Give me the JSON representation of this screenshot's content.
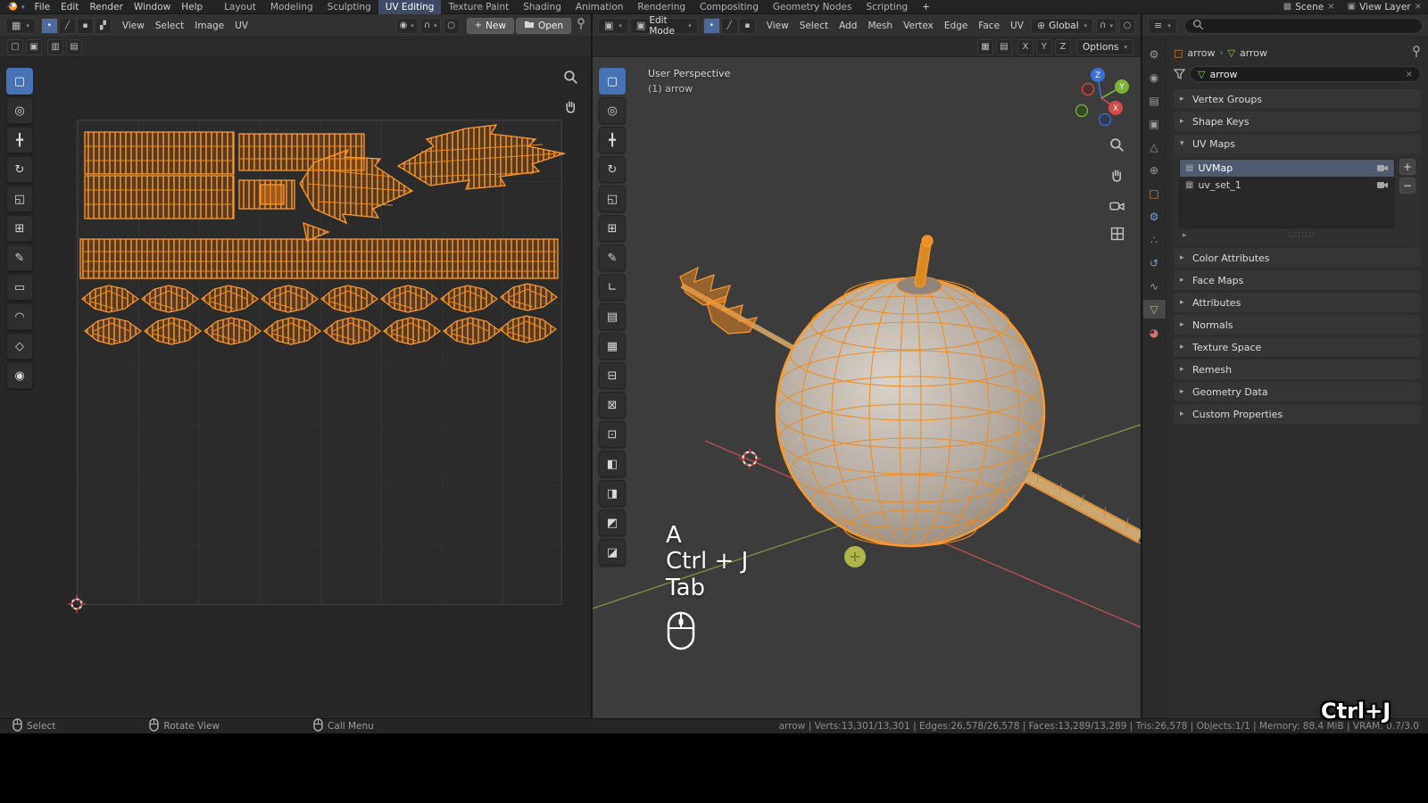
{
  "icons": {
    "dropdown_caret": "▾",
    "chevron_collapsed": "▸",
    "chevron_expanded": "▾",
    "breadcrumb_separator": "›",
    "plus": "+",
    "minus": "−",
    "close": "×",
    "magnet": "∩",
    "pivot": "◉",
    "proportional": "○",
    "globe": "⊕",
    "editor_uv": "▦",
    "editor_3d": "▣",
    "editor_props": "≡",
    "mode_edit": "▣",
    "scene": "▦",
    "view_layer": "▣",
    "object_data": "▽",
    "object": "□",
    "uvmap_item": "▦",
    "grip": "∷∷∷∷",
    "list_specials": "▸",
    "overlay_a": "▢",
    "overlay_b": "▣",
    "overlay_c": "▥",
    "overlay_d": "▤",
    "snap_grid": "▦"
  },
  "topbar": {
    "menus": [
      "File",
      "Edit",
      "Render",
      "Window",
      "Help"
    ],
    "tabs": [
      {
        "label": "Layout"
      },
      {
        "label": "Modeling"
      },
      {
        "label": "Sculpting"
      },
      {
        "label": "UV Editing",
        "active": true
      },
      {
        "label": "Texture Paint"
      },
      {
        "label": "Shading"
      },
      {
        "label": "Animation"
      },
      {
        "label": "Rendering"
      },
      {
        "label": "Compositing"
      },
      {
        "label": "Geometry Nodes"
      },
      {
        "label": "Scripting"
      }
    ],
    "add_tab_label": "+",
    "scene_selector": {
      "label": "Scene"
    },
    "view_layer_selector": {
      "label": "View Layer"
    }
  },
  "uv_editor": {
    "menus": [
      "View",
      "Select",
      "Image",
      "UV"
    ],
    "select_modes": [
      {
        "glyph": "•",
        "dn": "uv-vertex-select-button",
        "active": true
      },
      {
        "glyph": "╱",
        "dn": "uv-edge-select-button"
      },
      {
        "glyph": "▪",
        "dn": "uv-face-select-button"
      },
      {
        "glyph": "▞",
        "dn": "uv-island-select-button"
      }
    ],
    "new_button": "New",
    "open_button": "Open",
    "toolbar": [
      {
        "glyph": "▢",
        "dn": "uv-tweak-tool",
        "active": true
      },
      {
        "glyph": "◎",
        "dn": "uv-cursor-tool"
      },
      {
        "glyph": "╋",
        "dn": "uv-move-tool"
      },
      {
        "glyph": "↻",
        "dn": "uv-rotate-tool"
      },
      {
        "glyph": "◱",
        "dn": "uv-scale-tool"
      },
      {
        "glyph": "⊞",
        "dn": "uv-transform-tool"
      },
      {
        "glyph": "✎",
        "dn": "uv-annotate-tool"
      },
      {
        "glyph": "▭",
        "dn": "uv-rip-region-tool"
      },
      {
        "glyph": "◠",
        "dn": "uv-sculpt-tool"
      },
      {
        "glyph": "◇",
        "dn": "uv-relax-tool"
      },
      {
        "glyph": "◉",
        "dn": "uv-pin-tool"
      }
    ]
  },
  "viewport": {
    "mode_label": "Edit Mode",
    "select_modes": [
      {
        "glyph": "•",
        "dn": "vertex-select-button",
        "active": true
      },
      {
        "glyph": "╱",
        "dn": "edge-select-button"
      },
      {
        "glyph": "▪",
        "dn": "face-select-button"
      }
    ],
    "menus": [
      "View",
      "Select",
      "Add",
      "Mesh",
      "Vertex",
      "Edge",
      "Face",
      "UV"
    ],
    "orientation_label": "Global",
    "mirror_toggles": [
      "X",
      "Y",
      "Z"
    ],
    "options_label": "Options",
    "overlay": {
      "perspective": "User Perspective",
      "object": "(1) arrow"
    },
    "keycast": [
      "A",
      "Ctrl + J",
      "Tab"
    ],
    "toolbar": [
      {
        "glyph": "▢",
        "dn": "tweak-tool",
        "active": true
      },
      {
        "glyph": "◎",
        "dn": "cursor-tool"
      },
      {
        "glyph": "╋",
        "dn": "move-tool"
      },
      {
        "glyph": "↻",
        "dn": "rotate-tool"
      },
      {
        "glyph": "◱",
        "dn": "scale-tool"
      },
      {
        "glyph": "⊞",
        "dn": "transform-tool"
      },
      {
        "glyph": "✎",
        "dn": "annotate-tool"
      },
      {
        "glyph": "∟",
        "dn": "measure-tool"
      },
      {
        "glyph": "▤",
        "dn": "add-cube-tool"
      },
      {
        "glyph": "▦",
        "dn": "extrude-region-tool"
      },
      {
        "glyph": "⊟",
        "dn": "inset-faces-tool"
      },
      {
        "glyph": "⊠",
        "dn": "bevel-tool"
      },
      {
        "glyph": "⊡",
        "dn": "loop-cut-tool"
      },
      {
        "glyph": "◧",
        "dn": "knife-tool"
      },
      {
        "glyph": "◨",
        "dn": "poly-build-tool"
      },
      {
        "glyph": "◩",
        "dn": "spin-tool"
      },
      {
        "glyph": "◪",
        "dn": "smooth-tool"
      }
    ]
  },
  "properties": {
    "tabs": [
      {
        "glyph": "⚙",
        "cls": "c-gray",
        "dn": "tab-tool"
      },
      {
        "glyph": "◉",
        "cls": "c-gray",
        "dn": "tab-render"
      },
      {
        "glyph": "▤",
        "cls": "c-gray",
        "dn": "tab-output"
      },
      {
        "glyph": "▣",
        "cls": "c-gray",
        "dn": "tab-view-layer"
      },
      {
        "glyph": "△",
        "cls": "c-gray",
        "dn": "tab-scene"
      },
      {
        "glyph": "⊕",
        "cls": "c-gray",
        "dn": "tab-world"
      },
      {
        "glyph": "□",
        "cls": "c-orange",
        "dn": "tab-object"
      },
      {
        "glyph": "⚙",
        "cls": "c-blue",
        "dn": "tab-modifiers"
      },
      {
        "glyph": "∴",
        "cls": "c-blue",
        "dn": "tab-particles"
      },
      {
        "glyph": "↺",
        "cls": "c-blue",
        "dn": "tab-physics"
      },
      {
        "glyph": "∿",
        "cls": "c-gray",
        "dn": "tab-constraints"
      },
      {
        "glyph": "▽",
        "cls": "c-green",
        "dn": "tab-object-data",
        "active": true
      },
      {
        "glyph": "◕",
        "cls": "c-red",
        "dn": "tab-material"
      }
    ],
    "breadcrumb": {
      "object_name": "arrow",
      "data_name": "arrow"
    },
    "filter_value": "arrow",
    "panels_top": [
      {
        "label": "Vertex Groups"
      },
      {
        "label": "Shape Keys"
      }
    ],
    "uv_maps_panel": {
      "label": "UV Maps",
      "items": [
        {
          "name": "UVMap",
          "active": true
        },
        {
          "name": "uv_set_1"
        }
      ]
    },
    "panels_bottom": [
      {
        "label": "Color Attributes"
      },
      {
        "label": "Face Maps"
      },
      {
        "label": "Attributes"
      },
      {
        "label": "Normals"
      },
      {
        "label": "Texture Space"
      },
      {
        "label": "Remesh"
      },
      {
        "label": "Geometry Data"
      },
      {
        "label": "Custom Properties"
      }
    ]
  },
  "statusbar": {
    "hints": [
      {
        "label": "Select",
        "dn": "status-hint-select"
      },
      {
        "label": "Rotate View",
        "dn": "status-hint-rotate-view"
      },
      {
        "label": "Call Menu",
        "dn": "status-hint-call-menu"
      }
    ],
    "stats": "arrow | Verts:13,301/13,301 | Edges:26,578/26,578 | Faces:13,289/13,289 | Tris:26,578 | Objects:1/1 | Memory: 88.4 MiB | VRAM: 0.7/3.0",
    "keycast_watermark": "Ctrl+J"
  },
  "colors": {
    "accent": "#4772b3",
    "selection_orange": "#ff9a2a"
  }
}
